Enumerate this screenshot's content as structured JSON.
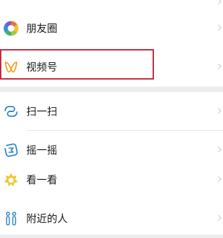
{
  "discover_menu": {
    "items": [
      {
        "id": "moments",
        "label": "朋友圈",
        "icon": "moments-icon"
      },
      {
        "id": "channels",
        "label": "视频号",
        "icon": "channels-icon"
      },
      {
        "id": "scan",
        "label": "扫一扫",
        "icon": "scan-icon"
      },
      {
        "id": "shake",
        "label": "摇一摇",
        "icon": "shake-icon"
      },
      {
        "id": "top_stories",
        "label": "看一看",
        "icon": "top-stories-icon"
      },
      {
        "id": "people_nearby",
        "label": "附近的人",
        "icon": "people-nearby-icon"
      }
    ]
  },
  "highlight": {
    "target": "channels",
    "color": "#c4283a"
  },
  "colors": {
    "background": "#ededed",
    "row": "#ffffff",
    "divider": "#e6e6e6",
    "text": "#181818",
    "chevron": "#c7c7c7",
    "scan_icon": "#2b86c6",
    "shake_icon": "#2b86c6",
    "channels_icon": "#f0a020",
    "top_stories_icon": "#f1c52c",
    "people_nearby_icon": "#2b86c6"
  }
}
